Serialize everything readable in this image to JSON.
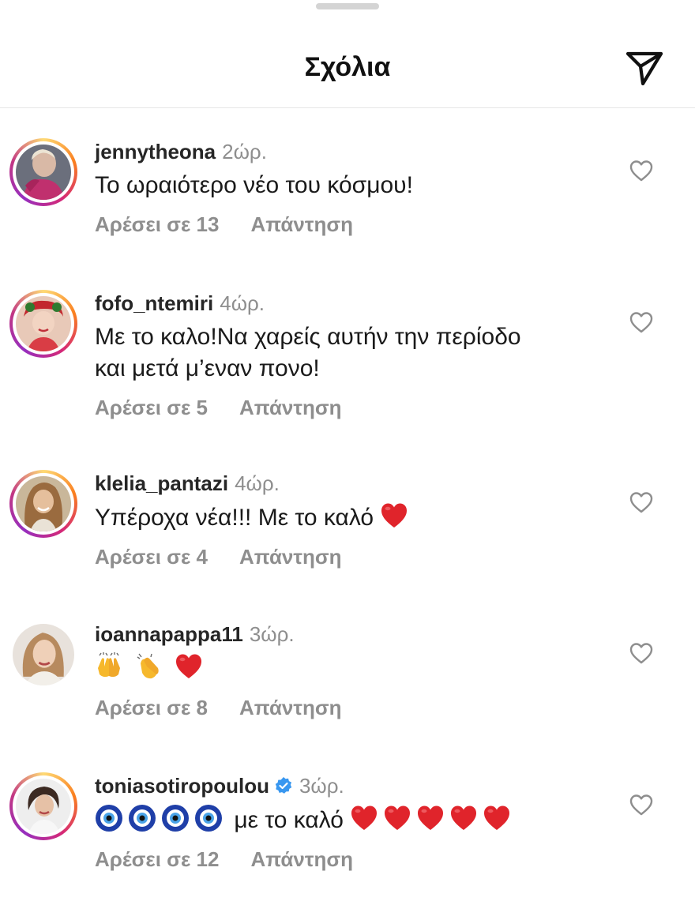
{
  "header": {
    "title": "Σχόλια",
    "send_icon": "send-paper-plane-icon"
  },
  "colors": {
    "text": "#262626",
    "muted": "#8e8e8e",
    "heart_red": "#e0242b",
    "verified_blue": "#3897f0"
  },
  "comments": [
    {
      "username": "jennytheona",
      "time": "2ώρ.",
      "text_lines": [
        "Το ωραιότερο νέο του κόσμου!"
      ],
      "likes": "Αρέσει σε 13",
      "reply": "Απάντηση",
      "story_ring": true,
      "verified": false
    },
    {
      "username": "fofo_ntemiri",
      "time": "4ώρ.",
      "text_lines": [
        "Με το καλο!Να χαρείς αυτήν την περίοδο",
        "και μετά μ’εναν πονο!"
      ],
      "likes": "Αρέσει σε 5",
      "reply": "Απάντηση",
      "story_ring": true,
      "verified": false
    },
    {
      "username": "klelia_pantazi",
      "time": "4ώρ.",
      "text_lines": [
        "Υπέροχα νέα!!! Με το καλό"
      ],
      "emojis_after": [
        "red-heart"
      ],
      "likes": "Αρέσει σε 4",
      "reply": "Απάντηση",
      "story_ring": true,
      "verified": false
    },
    {
      "username": "ioannapappa11",
      "time": "3ώρ.",
      "text_lines": [
        ""
      ],
      "emojis_before": [
        "raising-hands",
        "clapping-hands",
        "red-heart"
      ],
      "likes": "Αρέσει σε 8",
      "reply": "Απάντηση",
      "story_ring": false,
      "verified": false
    },
    {
      "username": "toniasotiropoulou",
      "time": "3ώρ.",
      "text_lines": [
        "με το καλό"
      ],
      "emojis_before": [
        "nazar-amulet",
        "nazar-amulet",
        "nazar-amulet",
        "nazar-amulet"
      ],
      "emojis_after": [
        "red-heart",
        "red-heart",
        "red-heart",
        "red-heart",
        "red-heart"
      ],
      "likes": "Αρέσει σε 12",
      "reply": "Απάντηση",
      "story_ring": true,
      "verified": true
    }
  ]
}
